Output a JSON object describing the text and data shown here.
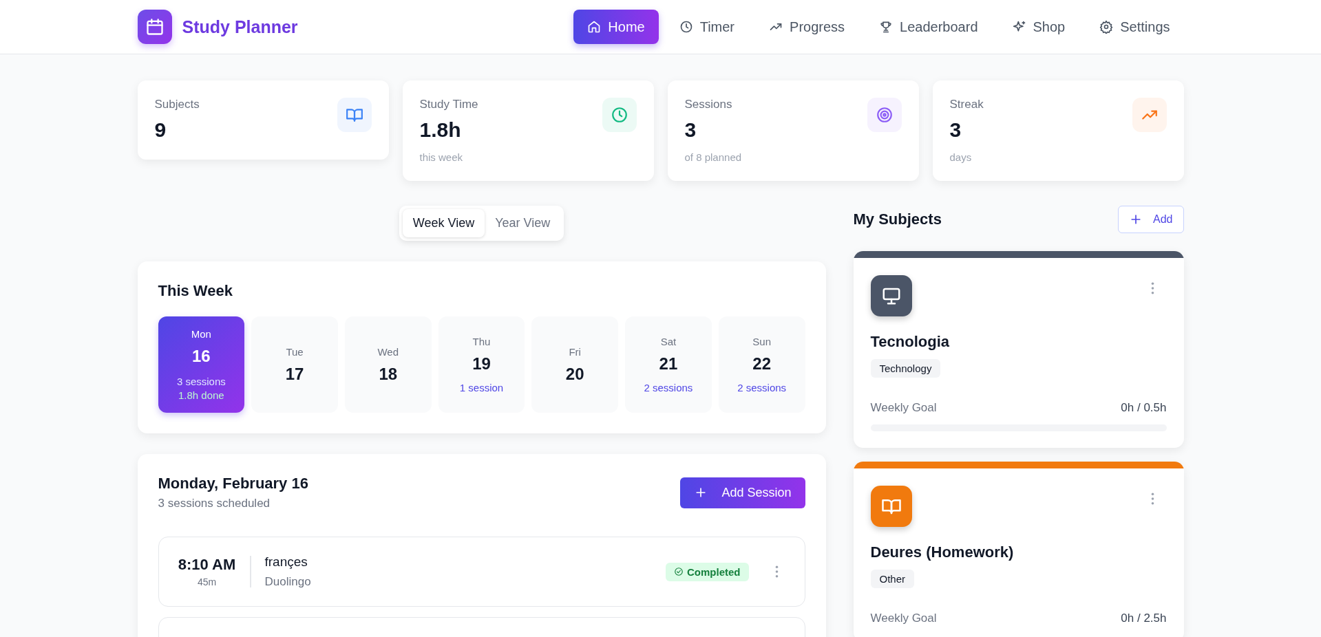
{
  "app": {
    "title": "Study Planner"
  },
  "nav": [
    {
      "label": "Home",
      "selected": true
    },
    {
      "label": "Timer",
      "selected": false
    },
    {
      "label": "Progress",
      "selected": false
    },
    {
      "label": "Leaderboard",
      "selected": false
    },
    {
      "label": "Shop",
      "selected": false
    },
    {
      "label": "Settings",
      "selected": false
    }
  ],
  "stats": [
    {
      "label": "Subjects",
      "value": "9",
      "color": "#3b82f6"
    },
    {
      "label": "Study Time",
      "value": "1.8h",
      "note": "this week",
      "color": "#10b981"
    },
    {
      "label": "Sessions",
      "value": "3",
      "note": "of 8 planned",
      "color": "#8b5cf6"
    },
    {
      "label": "Streak",
      "value": "3",
      "note": "days",
      "color": "#f97316"
    }
  ],
  "view_tabs": [
    {
      "label": "Week View",
      "selected": true
    },
    {
      "label": "Year View",
      "selected": false
    }
  ],
  "week": {
    "title": "This Week",
    "days": [
      {
        "day": "Mon",
        "date": "16",
        "sessions": "3 sessions",
        "done": "1.8h done",
        "selected": true
      },
      {
        "day": "Tue",
        "date": "17",
        "selected": false
      },
      {
        "day": "Wed",
        "date": "18",
        "selected": false
      },
      {
        "day": "Thu",
        "date": "19",
        "sessions": "1 session",
        "selected": false
      },
      {
        "day": "Fri",
        "date": "20",
        "selected": false
      },
      {
        "day": "Sat",
        "date": "21",
        "sessions": "2 sessions",
        "selected": false
      },
      {
        "day": "Sun",
        "date": "22",
        "sessions": "2 sessions",
        "selected": false
      }
    ]
  },
  "day_panel": {
    "title": "Monday, February 16",
    "subtitle": "3 sessions scheduled",
    "add_button": "Add Session",
    "sessions": [
      {
        "time": "8:10 AM",
        "duration": "45m",
        "subject": "françes",
        "note": "Duolingo",
        "status": "Completed"
      }
    ]
  },
  "subjects": {
    "title": "My Subjects",
    "add_button": "Add",
    "items": [
      {
        "name": "Tecnologia",
        "tag": "Technology",
        "color": "#4b5567",
        "goal_label": "Weekly Goal",
        "goal": "0h / 0.5h",
        "level": 0
      },
      {
        "name": "Deures (Homework)",
        "tag": "Other",
        "color": "#f17a0e",
        "goal_label": "Weekly Goal",
        "goal": "0h / 2.5h"
      }
    ]
  }
}
